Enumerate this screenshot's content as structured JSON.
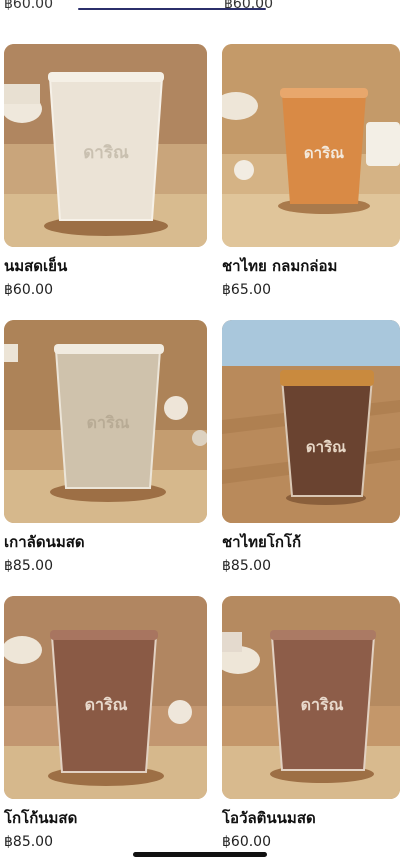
{
  "top_partial": {
    "left_price": "฿60.00",
    "right_price": "฿60.00"
  },
  "brand_mark": "ดาริณ",
  "products": [
    {
      "name": "นมสดเย็น",
      "price": "฿60.00",
      "drink_color": "#e9e1d3",
      "bg_color": "#b9946c"
    },
    {
      "name": "ชาไทย กลมกล่อม",
      "price": "฿65.00",
      "drink_color": "#d98a45",
      "bg_color": "#c79e6e"
    },
    {
      "name": "เกาลัดนมสด",
      "price": "฿85.00",
      "drink_color": "#cfc2ac",
      "bg_color": "#b58c5f"
    },
    {
      "name": "ชาไทยโกโก้",
      "price": "฿85.00",
      "drink_color": "#6a4330",
      "bg_color": "#8e6140"
    },
    {
      "name": "โกโก้นมสด",
      "price": "฿85.00",
      "drink_color": "#8a5a45",
      "bg_color": "#b98a5c"
    },
    {
      "name": "โอวัลตินนมสด",
      "price": "฿60.00",
      "drink_color": "#8d5d49",
      "bg_color": "#bb8e62"
    }
  ]
}
